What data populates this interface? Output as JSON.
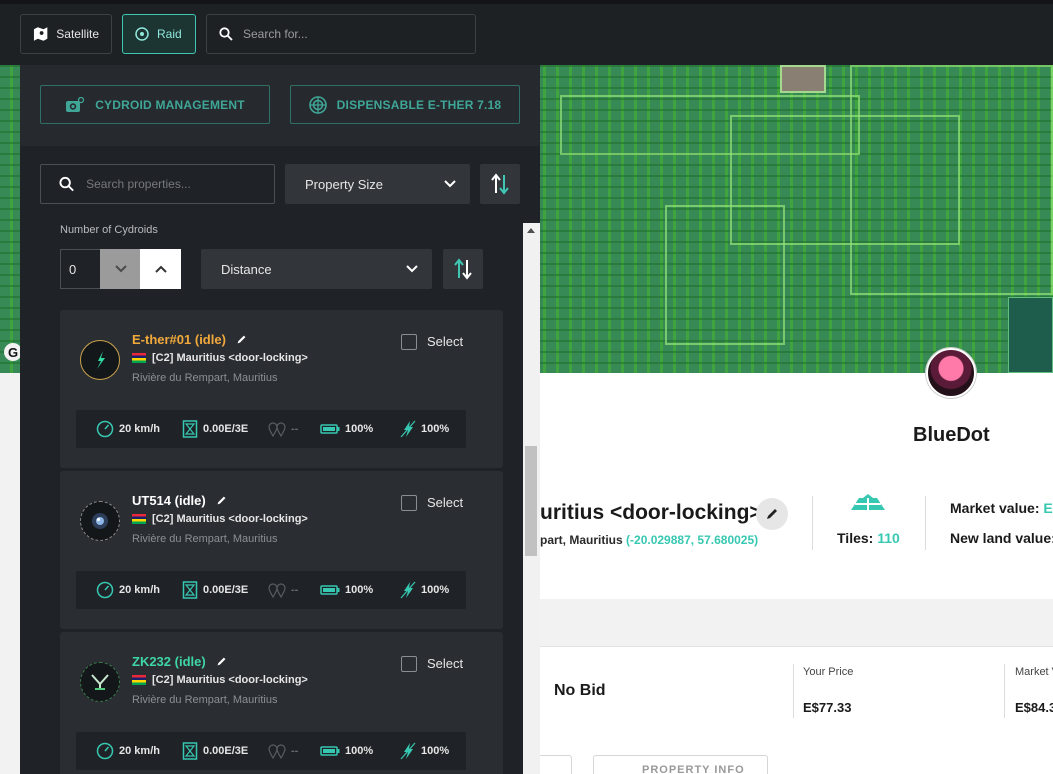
{
  "topbar": {
    "satellite_label": "Satellite",
    "raid_label": "Raid",
    "search_placeholder": "Search for..."
  },
  "map": {
    "corner_glyph": "G"
  },
  "panel": {
    "cydroid_management_label": "CYDROID MANAGEMENT",
    "dispensable_label": "DISPENSABLE E-THER 7.18",
    "search_placeholder": "Search properties...",
    "sort_select_value": "Property Size",
    "number_label": "Number of Cydroids",
    "number_value": "0",
    "distance_select_value": "Distance",
    "cydroids": [
      {
        "name": "E-ther#01 (idle)",
        "name_color": "#f2a93b",
        "property": "[C2] Mauritius <door-locking>",
        "address": "Rivière du Rempart, Mauritius",
        "select_label": "Select",
        "speed": "20 km/h",
        "cost": "0.00E/3E",
        "distance": "--",
        "battery": "100%",
        "power": "100%"
      },
      {
        "name": "UT514 (idle)",
        "name_color": "#ffffff",
        "property": "[C2] Mauritius <door-locking>",
        "address": "Rivière du Rempart, Mauritius",
        "select_label": "Select",
        "speed": "20 km/h",
        "cost": "0.00E/3E",
        "distance": "--",
        "battery": "100%",
        "power": "100%"
      },
      {
        "name": "ZK232 (idle)",
        "name_color": "#3fd6a6",
        "property": "[C2] Mauritius <door-locking>",
        "address": "Rivière du Rempart, Mauritius",
        "select_label": "Select",
        "speed": "20 km/h",
        "cost": "0.00E/3E",
        "distance": "--",
        "battery": "100%",
        "power": "100%"
      }
    ]
  },
  "property": {
    "owner": "BlueDot",
    "title": "uritius <door-locking>",
    "location": "part, Mauritius",
    "coords": "(-20.029887, 57.680025)",
    "tiles_label": "Tiles:",
    "tiles_value": "110",
    "market_value_label": "Market value:",
    "market_value_partial": "E$",
    "new_land_value_label": "New land value:",
    "no_bid": "No Bid",
    "your_price_label": "Your Price",
    "your_price_value": "E$77.33",
    "market_price_label": "Market V",
    "market_price_value": "E$84.3",
    "bottom_button_label": "PROPERTY INFO"
  },
  "colors": {
    "accent": "#3fc7b4",
    "panel_bg": "#1f2226",
    "card_bg": "#2a2e33",
    "map_green": "#3fa43f"
  }
}
